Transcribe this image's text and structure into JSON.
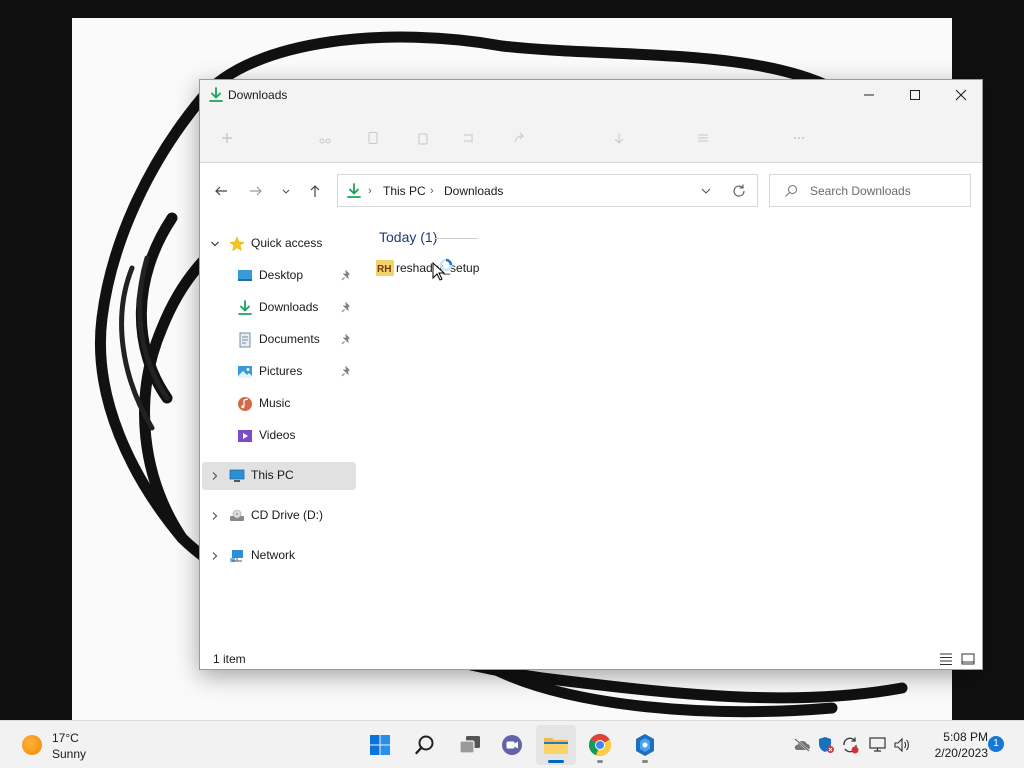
{
  "window": {
    "title": "Downloads",
    "title_icon": "downloads-icon"
  },
  "address": {
    "crumbs": [
      "This PC",
      "Downloads"
    ]
  },
  "search": {
    "placeholder": "Search Downloads"
  },
  "nav": {
    "quick_access": "Quick access",
    "items": [
      {
        "label": "Desktop",
        "icon": "desktop-icon",
        "pinned": true
      },
      {
        "label": "Downloads",
        "icon": "downloads-icon",
        "pinned": true
      },
      {
        "label": "Documents",
        "icon": "documents-icon",
        "pinned": true
      },
      {
        "label": "Pictures",
        "icon": "pictures-icon",
        "pinned": true
      },
      {
        "label": "Music",
        "icon": "music-icon",
        "pinned": false
      },
      {
        "label": "Videos",
        "icon": "videos-icon",
        "pinned": false
      }
    ],
    "this_pc": "This PC",
    "cd_drive": "CD Drive (D:)",
    "network": "Network"
  },
  "content": {
    "group_header": "Today (1)",
    "files": [
      {
        "name": "reshader_setup",
        "icon": "reshade-icon"
      }
    ]
  },
  "status": {
    "item_count": "1 item"
  },
  "taskbar": {
    "weather_temp": "17°C",
    "weather_cond": "Sunny",
    "apps": [
      "start",
      "search",
      "task-view",
      "chat",
      "file-explorer",
      "chrome",
      "app"
    ],
    "clock_time": "5:08 PM",
    "clock_date": "2/20/2023",
    "notification_count": "1"
  },
  "colors": {
    "accent": "#0067c0",
    "downloads_green": "#1aa260",
    "group_header": "#1f3a7a",
    "selected_bg": "#e1e1e1"
  }
}
